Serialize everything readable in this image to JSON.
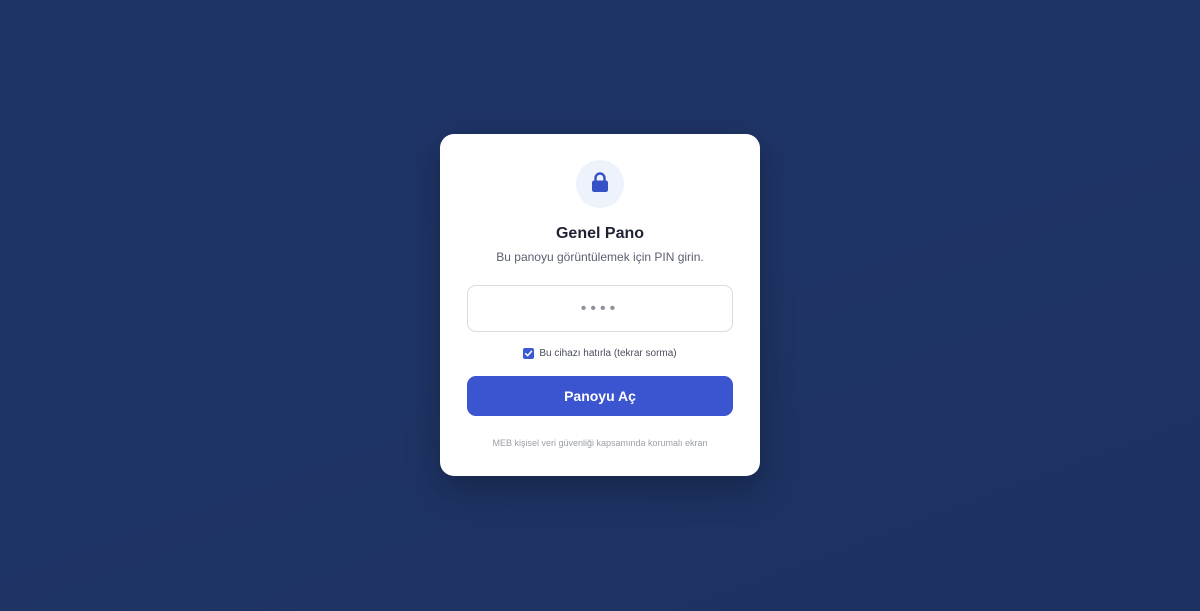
{
  "colors": {
    "background": "#1f3466",
    "card": "#ffffff",
    "accent": "#3b54cf",
    "lock_icon": "#3652c7",
    "lock_badge": "#eef2fb"
  },
  "card": {
    "icon": "lock-icon",
    "title": "Genel Pano",
    "subtitle": "Bu panoyu görüntülemek için PIN girin.",
    "pin_input": {
      "value": "",
      "placeholder": "••••"
    },
    "remember": {
      "checked": true,
      "label": "Bu cihazı hatırla (tekrar sorma)"
    },
    "submit_label": "Panoyu Aç",
    "footer_note": "MEB kişisel veri güvenliği kapsamında korumalı ekran"
  }
}
